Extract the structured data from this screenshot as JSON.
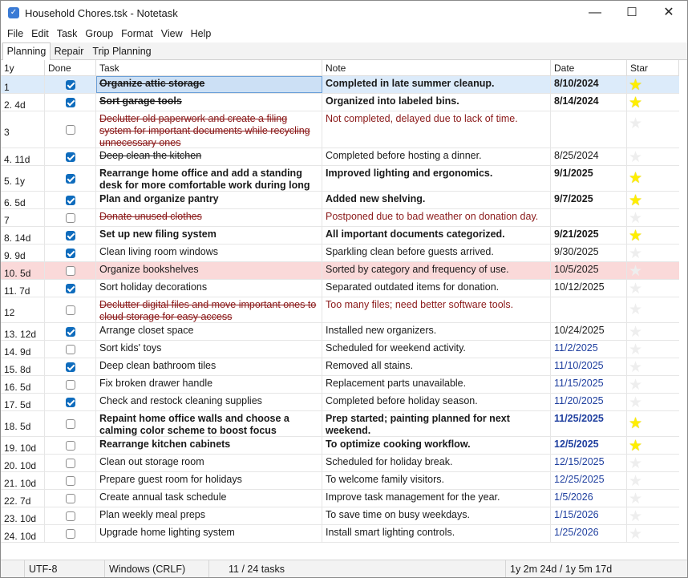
{
  "window": {
    "title": "Household Chores.tsk - Notetask",
    "minimize_glyph": "—",
    "maximize_glyph": "☐",
    "close_glyph": "✕",
    "icon": "checkbox-app-icon"
  },
  "menu": [
    "File",
    "Edit",
    "Task",
    "Group",
    "Format",
    "View",
    "Help"
  ],
  "tabs": [
    "Planning",
    "Repair",
    "Trip Planning"
  ],
  "active_tab": "Planning",
  "columns": {
    "age": "1y",
    "done": "Done",
    "task": "Task",
    "note": "Note",
    "date": "Date",
    "star": "Star"
  },
  "colors": {
    "accent": "#0f6cbd",
    "row_highlight_pink": "#fad9d9",
    "row_highlight_blue": "#dcebfa",
    "star_gold": "#ffee00",
    "star_empty": "#eeeeee",
    "red_text": "#8b1a1a",
    "blue_date": "#1f3f9f"
  },
  "rows": [
    {
      "age": "1",
      "done": true,
      "task": "Organize attic storage",
      "note": "Completed in late summer cleanup.",
      "date": "8/10/2024",
      "star": true
    },
    {
      "age": "2. 4d",
      "done": true,
      "task": "Sort garage tools",
      "note": "Organized into labeled bins.",
      "date": "8/14/2024",
      "star": true
    },
    {
      "age": "3",
      "done": false,
      "task": "Declutter old paperwork and create a filing system for important documents while recycling unnecessary ones",
      "note": "Not completed, delayed due to lack of time.",
      "date": "",
      "star": false
    },
    {
      "age": "4. 11d",
      "done": true,
      "task": "Deep clean the kitchen",
      "note": "Completed before hosting a dinner.",
      "date": "8/25/2024",
      "star": false
    },
    {
      "age": "5. 1y",
      "done": true,
      "task": "Rearrange home office and add a standing desk for more comfortable work during long hours",
      "note": "Improved lighting and ergonomics.",
      "date": "9/1/2025",
      "star": true
    },
    {
      "age": "6. 5d",
      "done": true,
      "task": "Plan and organize pantry",
      "note": "Added new shelving.",
      "date": "9/7/2025",
      "star": true
    },
    {
      "age": "7",
      "done": false,
      "task": "Donate unused clothes",
      "note": "Postponed due to bad weather on donation day.",
      "date": "",
      "star": false
    },
    {
      "age": "8. 14d",
      "done": true,
      "task": "Set up new filing system",
      "note": "All important documents categorized.",
      "date": "9/21/2025",
      "star": true
    },
    {
      "age": "9. 9d",
      "done": true,
      "task": "Clean living room windows",
      "note": "Sparkling clean before guests arrived.",
      "date": "9/30/2025",
      "star": false
    },
    {
      "age": "10. 5d",
      "done": false,
      "task": "Organize bookshelves",
      "note": "Sorted by category and frequency of use.",
      "date": "10/5/2025",
      "star": false
    },
    {
      "age": "11. 7d",
      "done": true,
      "task": "Sort holiday decorations",
      "note": "Separated outdated items for donation.",
      "date": "10/12/2025",
      "star": false
    },
    {
      "age": "12",
      "done": false,
      "task": "Declutter digital files and move important ones to cloud storage for easy access",
      "note": "Too many files; need better software tools.",
      "date": "",
      "star": false
    },
    {
      "age": "13. 12d",
      "done": true,
      "task": "Arrange closet space",
      "note": "Installed new organizers.",
      "date": "10/24/2025",
      "star": false
    },
    {
      "age": "14. 9d",
      "done": false,
      "task": "Sort kids' toys",
      "note": "Scheduled for weekend activity.",
      "date": "11/2/2025",
      "star": false
    },
    {
      "age": "15. 8d",
      "done": true,
      "task": "Deep clean bathroom tiles",
      "note": "Removed all stains.",
      "date": "11/10/2025",
      "star": false
    },
    {
      "age": "16. 5d",
      "done": false,
      "task": "Fix broken drawer handle",
      "note": "Replacement parts unavailable.",
      "date": "11/15/2025",
      "star": false
    },
    {
      "age": "17. 5d",
      "done": true,
      "task": "Check and restock cleaning supplies",
      "note": "Completed before holiday season.",
      "date": "11/20/2025",
      "star": false
    },
    {
      "age": "18. 5d",
      "done": false,
      "task": "Repaint home office walls and choose a calming color scheme to boost focus",
      "note": "Prep started; painting planned for next weekend.",
      "date": "11/25/2025",
      "star": true
    },
    {
      "age": "19. 10d",
      "done": false,
      "task": "Rearrange kitchen cabinets",
      "note": "To optimize cooking workflow.",
      "date": "12/5/2025",
      "star": true
    },
    {
      "age": "20. 10d",
      "done": false,
      "task": "Clean out storage room",
      "note": "Scheduled for holiday break.",
      "date": "12/15/2025",
      "star": false
    },
    {
      "age": "21. 10d",
      "done": false,
      "task": "Prepare guest room for holidays",
      "note": "To welcome family visitors.",
      "date": "12/25/2025",
      "star": false
    },
    {
      "age": "22. 7d",
      "done": false,
      "task": "Create annual task schedule",
      "note": "Improve task management for the year.",
      "date": "1/5/2026",
      "star": false
    },
    {
      "age": "23. 10d",
      "done": false,
      "task": "Plan weekly meal preps",
      "note": "To save time on busy weekdays.",
      "date": "1/15/2026",
      "star": false
    },
    {
      "age": "24. 10d",
      "done": false,
      "task": "Upgrade home lighting system",
      "note": "Install smart lighting controls.",
      "date": "1/25/2026",
      "star": false
    }
  ],
  "status": {
    "encoding": "UTF-8",
    "line_endings": "Windows (CRLF)",
    "tasks": "11 / 24 tasks",
    "duration": "1y 2m 24d / 1y 5m 17d"
  }
}
